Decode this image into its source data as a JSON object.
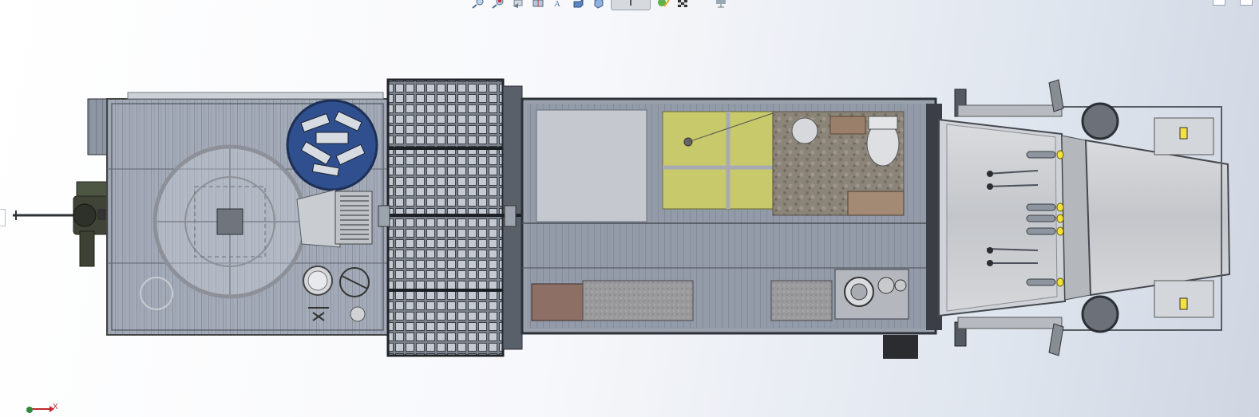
{
  "window": {
    "title": ""
  },
  "view_toolbar": {
    "buttons": [
      {
        "icon": "zoom-to-fit-icon"
      },
      {
        "icon": "zoom-to-area-icon"
      },
      {
        "icon": "previous-view-icon"
      },
      {
        "icon": "section-view-icon"
      },
      {
        "icon": "dynamic-annotation-icon"
      },
      {
        "icon": "view-orientation-icon"
      },
      {
        "icon": "display-style-icon"
      },
      {
        "icon": "hide-show-items-icon",
        "active": true
      },
      {
        "icon": "edit-appearance-icon"
      },
      {
        "icon": "apply-scene-icon"
      },
      {
        "icon": "view-settings-icon"
      }
    ]
  },
  "triad": {
    "axis_label": "X",
    "colors": {
      "x": "#c0262d",
      "y": "#2f8a3a"
    }
  },
  "model": {
    "view": "top",
    "colors": {
      "accent_blue": "#2f4f8f",
      "floor_mat": "#c8c96a",
      "body_gray": "#a9adb5",
      "lights": "#f4e23c"
    }
  }
}
